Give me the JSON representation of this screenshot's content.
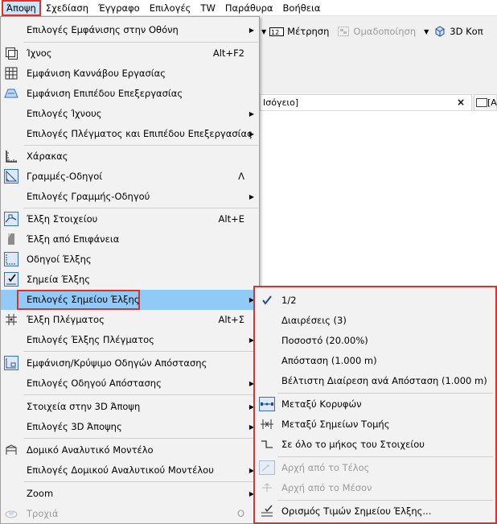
{
  "menubar": {
    "items": [
      "Άποψη",
      "Σχεδίαση",
      "Έγγραφο",
      "Επιλογές",
      "TW",
      "Παράθυρα",
      "Βοήθεια"
    ]
  },
  "toolbar": {
    "measure": "Μέτρηση",
    "group": "Ομαδοποίηση",
    "view3d": "3D Κοπ"
  },
  "tab": {
    "label": "Ισόγειο]",
    "close": "×",
    "second": "[A"
  },
  "menu": {
    "items": [
      {
        "label": "Επιλογές Εμφάνισης στην Οθόνη",
        "shortcut": "",
        "submenu": true
      },
      {
        "label": "Ίχνος",
        "shortcut": "Alt+F2",
        "submenu": false
      },
      {
        "label": "Εμφάνιση Καννάβου Εργασίας",
        "shortcut": "",
        "submenu": false
      },
      {
        "label": "Εμφάνιση Επιπέδου Επεξεργασίας",
        "shortcut": "",
        "submenu": false
      },
      {
        "label": "Επιλογές Ίχνους",
        "shortcut": "",
        "submenu": true
      },
      {
        "label": "Επιλογές Πλέγματος και Επιπέδου Επεξεργασίας",
        "shortcut": "",
        "submenu": true
      },
      {
        "label": "Χάρακας",
        "shortcut": "",
        "submenu": false
      },
      {
        "label": "Γραμμές-Οδηγοί",
        "shortcut": "Λ",
        "submenu": false
      },
      {
        "label": "Επιλογές Γραμμής-Οδηγού",
        "shortcut": "",
        "submenu": true
      },
      {
        "label": "Έλξη Στοιχείου",
        "shortcut": "Alt+E",
        "submenu": false
      },
      {
        "label": "Έλξη από Επιφάνεια",
        "shortcut": "",
        "submenu": false
      },
      {
        "label": "Οδηγοί Έλξης",
        "shortcut": "",
        "submenu": false
      },
      {
        "label": "Σημεία Έλξης",
        "shortcut": "",
        "submenu": false
      },
      {
        "label": "Επιλογές Σημείου Έλξης",
        "shortcut": "",
        "submenu": true
      },
      {
        "label": "Έλξη Πλέγματος",
        "shortcut": "Alt+Σ",
        "submenu": false
      },
      {
        "label": "Επιλογές Έλξης Πλέγματος",
        "shortcut": "",
        "submenu": true
      },
      {
        "label": "Εμφάνιση/Κρύψιμο Οδηγών Απόστασης",
        "shortcut": "",
        "submenu": false
      },
      {
        "label": "Επιλογές Οδηγού Απόστασης",
        "shortcut": "",
        "submenu": true
      },
      {
        "label": "Στοιχεία στην 3D Άποψη",
        "shortcut": "",
        "submenu": true
      },
      {
        "label": "Επιλογές 3D Άποψης",
        "shortcut": "",
        "submenu": true
      },
      {
        "label": "Δομικό Αναλυτικό Μοντέλο",
        "shortcut": "",
        "submenu": false
      },
      {
        "label": "Επιλογές Δομικού Αναλυτικού Μοντέλου",
        "shortcut": "",
        "submenu": true
      },
      {
        "label": "Zoom",
        "shortcut": "",
        "submenu": true
      },
      {
        "label": "Τροχιά",
        "shortcut": "O",
        "submenu": false
      }
    ]
  },
  "submenu": {
    "items": [
      {
        "label": "1/2"
      },
      {
        "label": "Διαιρέσεις (3)"
      },
      {
        "label": "Ποσοστό (20.00%)"
      },
      {
        "label": "Απόσταση (1.000 m)"
      },
      {
        "label": "Βέλτιστη Διαίρεση ανά Απόσταση (1.000 m)"
      },
      {
        "label": "Μεταξύ Κορυφών"
      },
      {
        "label": "Μεταξύ Σημείων Τομής"
      },
      {
        "label": "Σε όλο το μήκος του Στοιχείου"
      },
      {
        "label": "Αρχή από το Τέλος"
      },
      {
        "label": "Αρχή από το Μέσον"
      },
      {
        "label": "Ορισμός Τιμών Σημείου Έλξης..."
      }
    ]
  },
  "colors": {
    "highlight": "#91c9f7",
    "red_outline": "#e0302a",
    "icon_blue": "#3a6fb5"
  }
}
